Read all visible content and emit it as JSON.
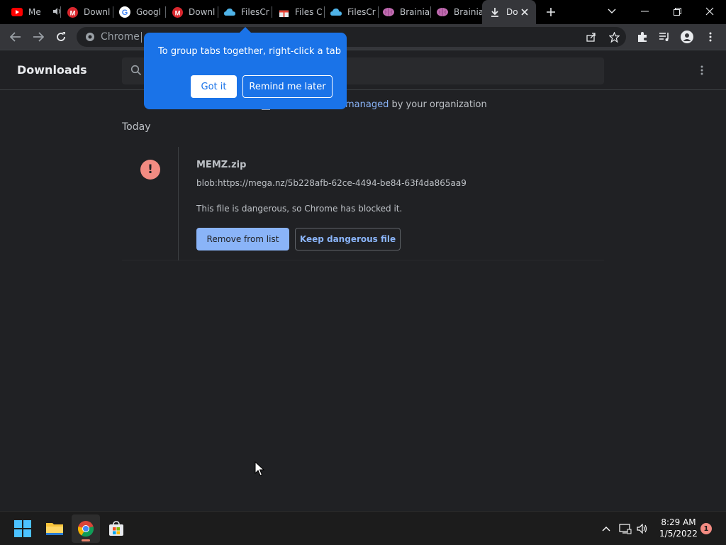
{
  "browser": {
    "tabs": [
      {
        "title": "Me",
        "favicon": "youtube-icon",
        "audio": true
      },
      {
        "title": "Downl",
        "favicon": "mega-icon"
      },
      {
        "title": "Googl",
        "favicon": "google-icon"
      },
      {
        "title": "Downl",
        "favicon": "mega-icon"
      },
      {
        "title": "FilesCr",
        "favicon": "cloud-icon"
      },
      {
        "title": "Files C",
        "favicon": "gift-icon"
      },
      {
        "title": "FilesCr",
        "favicon": "cloud-icon"
      },
      {
        "title": "Brainia",
        "favicon": "brain-icon"
      },
      {
        "title": "Brainia",
        "favicon": "brain-icon"
      },
      {
        "title": "Do",
        "favicon": "download-icon",
        "active": true
      }
    ],
    "omnibox": {
      "text": "Chrome"
    }
  },
  "downloads": {
    "title": "Downloads",
    "managed": {
      "link": "managed",
      "suffix": " by your organization"
    },
    "section": "Today",
    "items": [
      {
        "filename": "MEMZ.zip",
        "url": "blob:https://mega.nz/5b228afb-62ce-4494-be84-63f4da865aa9",
        "status": "This file is dangerous, so Chrome has blocked it.",
        "primary_action": "Remove from list",
        "secondary_action": "Keep dangerous file"
      }
    ]
  },
  "promo": {
    "text": "To group tabs together, right-click a tab",
    "got_it": "Got it",
    "remind": "Remind me later"
  },
  "taskbar": {
    "time": "8:29 AM",
    "date": "1/5/2022",
    "notifications": "1"
  },
  "colors": {
    "accent": "#8ab4f8",
    "promo": "#1a73e8",
    "danger": "#f28b82"
  }
}
